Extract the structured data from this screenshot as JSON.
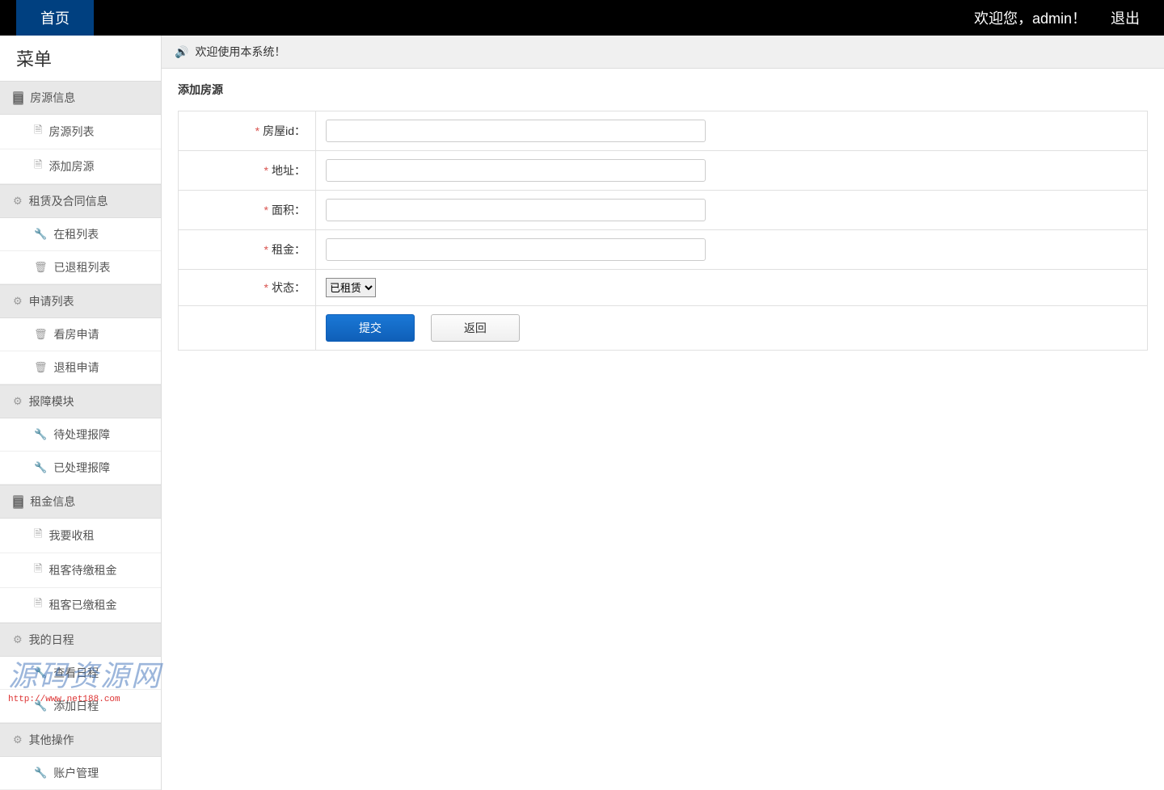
{
  "topbar": {
    "home": "首页",
    "welcome": "欢迎您，admin！",
    "logout": "退出"
  },
  "sidebar": {
    "title": "菜单",
    "groups": [
      {
        "label": "房源信息",
        "icon": "info",
        "items": [
          {
            "label": "房源列表",
            "icon": "file"
          },
          {
            "label": "添加房源",
            "icon": "file"
          }
        ]
      },
      {
        "label": "租赁及合同信息",
        "icon": "gear",
        "items": [
          {
            "label": "在租列表",
            "icon": "wrench"
          },
          {
            "label": "已退租列表",
            "icon": "trash"
          }
        ]
      },
      {
        "label": "申请列表",
        "icon": "gear",
        "items": [
          {
            "label": "看房申请",
            "icon": "trash"
          },
          {
            "label": "退租申请",
            "icon": "trash"
          }
        ]
      },
      {
        "label": "报障模块",
        "icon": "gear",
        "items": [
          {
            "label": "待处理报障",
            "icon": "wrench"
          },
          {
            "label": "已处理报障",
            "icon": "wrench"
          }
        ]
      },
      {
        "label": "租金信息",
        "icon": "info",
        "items": [
          {
            "label": "我要收租",
            "icon": "file"
          },
          {
            "label": "租客待缴租金",
            "icon": "file"
          },
          {
            "label": "租客已缴租金",
            "icon": "file"
          }
        ]
      },
      {
        "label": "我的日程",
        "icon": "gear",
        "items": [
          {
            "label": "查看日程",
            "icon": "wrench"
          },
          {
            "label": "添加日程",
            "icon": "wrench"
          }
        ]
      },
      {
        "label": "其他操作",
        "icon": "gear",
        "items": [
          {
            "label": "账户管理",
            "icon": "wrench"
          }
        ]
      }
    ]
  },
  "notice": {
    "text": "欢迎使用本系统！"
  },
  "form": {
    "title": "添加房源",
    "fields": {
      "house_id": {
        "label": "房屋id："
      },
      "address": {
        "label": "地址："
      },
      "area": {
        "label": "面积："
      },
      "rent": {
        "label": "租金："
      },
      "status": {
        "label": "状态：",
        "options": [
          "已租赁"
        ]
      }
    },
    "buttons": {
      "submit": "提交",
      "back": "返回"
    }
  },
  "watermark": {
    "text": "源码资源网",
    "url": "http://www.net188.com"
  },
  "glyphs": {
    "info": "▤",
    "gear": "⚙",
    "file": "🗎",
    "wrench": "🔧",
    "trash": "🗑",
    "speaker": "🔊"
  }
}
